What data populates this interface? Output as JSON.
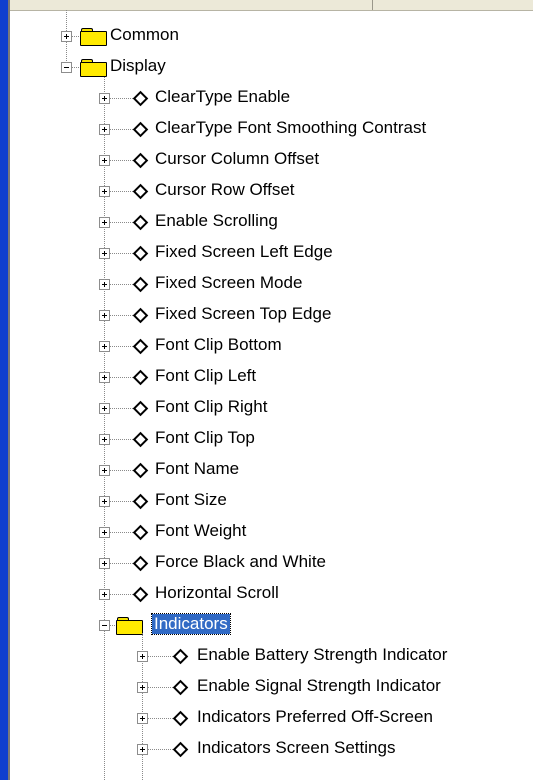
{
  "tree": {
    "folders": {
      "common": "Common",
      "display": "Display",
      "indicators": "Indicators"
    },
    "display_items": [
      "ClearType Enable",
      "ClearType Font Smoothing Contrast",
      "Cursor Column Offset",
      "Cursor Row Offset",
      "Enable Scrolling",
      "Fixed Screen Left Edge",
      "Fixed Screen Mode",
      "Fixed Screen Top Edge",
      "Font Clip Bottom",
      "Font Clip Left",
      "Font Clip Right",
      "Font Clip Top",
      "Font Name",
      "Font Size",
      "Font Weight",
      "Force Black and White",
      "Horizontal Scroll"
    ],
    "indicator_items": [
      "Enable Battery Strength Indicator",
      "Enable Signal Strength Indicator",
      "Indicators Preferred Off-Screen",
      "Indicators Screen Settings"
    ],
    "selected_item": "Indicators"
  },
  "colors": {
    "selection": "#316ac5",
    "folder": "#ffea00",
    "left_border": "#0f3fcf"
  },
  "icons": {
    "folder": "folder-icon",
    "setting": "diamond-icon",
    "expand": "plus-icon",
    "collapse": "minus-icon"
  }
}
